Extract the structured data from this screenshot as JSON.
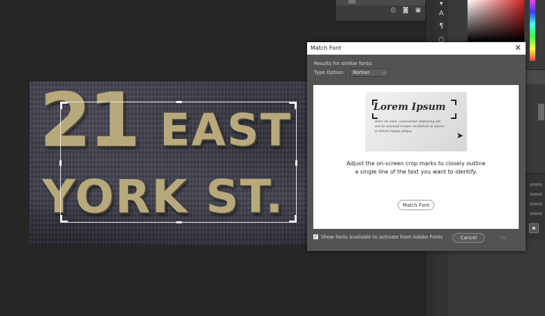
{
  "photo": {
    "line1_number": "21",
    "line1_word": "EAST",
    "line2": "YORK ST."
  },
  "panel_top": {
    "icons": [
      "stamp-icon",
      "camera-icon",
      "trash-icon"
    ]
  },
  "dialog": {
    "title": "Match Font",
    "close_glyph": "✕",
    "results_label": "Results for similar fonts:",
    "type_option_label": "Type Option:",
    "type_option_value": "Roman",
    "sample": {
      "heading": "Lorem Ipsum",
      "line1": "dolor sit amet, consectetur adipiscing elit",
      "line2": "sed do eiusmod tempor incididunt ut labore",
      "line3": "et dolore magna aliqua."
    },
    "instructions_line1": "Adjust the on-screen crop marks to closely outline",
    "instructions_line2": "a single line of the text you want to identify.",
    "match_button": "Match Font",
    "show_fonts_label": "Show fonts available to activate from Adobe Fonts",
    "show_fonts_checked": true,
    "cancel_button": "Cancel",
    "ok_button": "OK"
  },
  "colors": {
    "dialog_bg": "#535353",
    "canvas_bg": "#262626",
    "sign_text": "#b7a97c"
  }
}
